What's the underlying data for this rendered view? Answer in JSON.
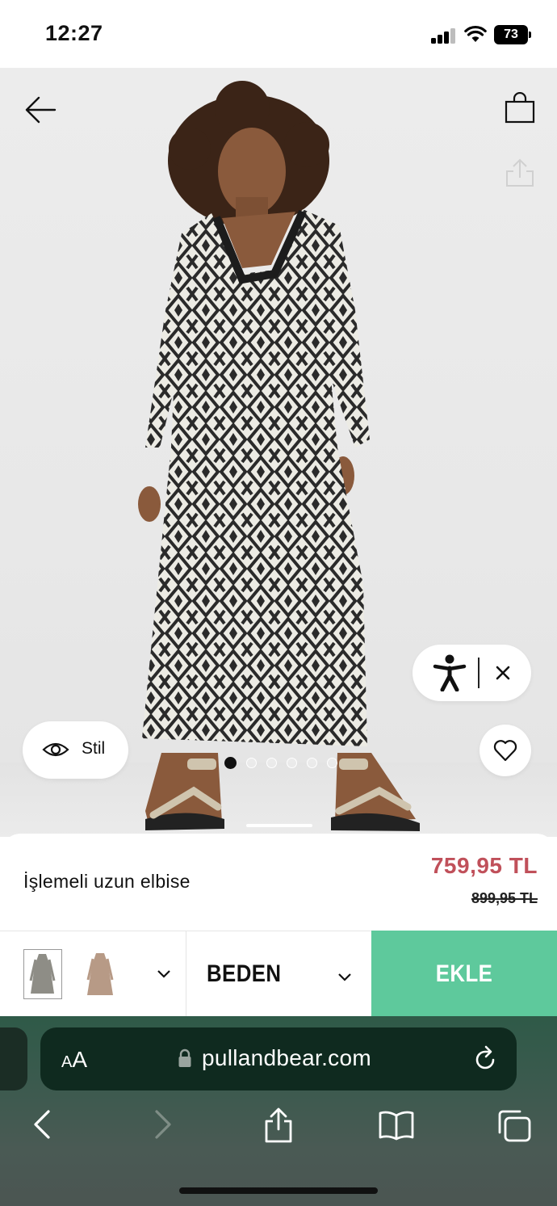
{
  "status_bar": {
    "time": "12:27",
    "battery": "73"
  },
  "product": {
    "name": "İşlemeli uzun elbise",
    "price_sale": "759,95 TL",
    "price_old": "899,95 TL"
  },
  "style_button": {
    "label": "Stil"
  },
  "gallery": {
    "image_count": 6,
    "active_index": 0
  },
  "action_bar": {
    "size_label": "BEDEN",
    "add_label": "EKLE"
  },
  "browser": {
    "aa_label_small": "A",
    "aa_label_large": "A",
    "url": "pullandbear.com"
  },
  "colors": {
    "sale_price": "#c0505a",
    "add_button": "#5ec99c"
  },
  "icons": {
    "back": "arrow-left-icon",
    "bag": "shopping-bag-icon",
    "share": "share-icon",
    "accessibility": "accessibility-icon",
    "close": "close-icon",
    "eye": "eye-icon",
    "favorite": "heart-icon"
  }
}
